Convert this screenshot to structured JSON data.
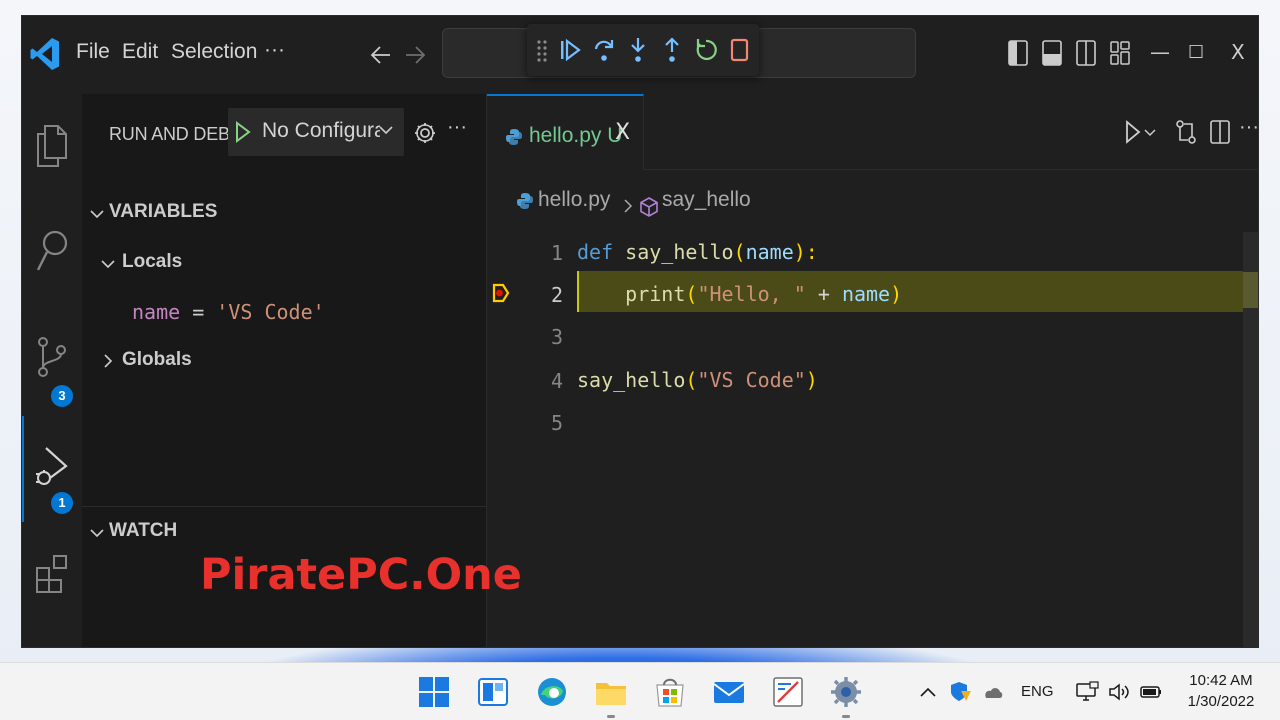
{
  "titlebar": {
    "menu": [
      "File",
      "Edit",
      "Selection",
      "···"
    ],
    "window_controls": [
      "—",
      "☐",
      "X"
    ]
  },
  "activity_bar": {
    "source_control_badge": "3",
    "run_debug_badge": "1"
  },
  "sidebar": {
    "title": "RUN AND DEBUG",
    "config_label": "No Configurations",
    "variables_header": "VARIABLES",
    "locals_label": "Locals",
    "local_var": {
      "name": "name",
      "eq": " = ",
      "value": "'VS Code'"
    },
    "globals_label": "Globals",
    "watch_header": "WATCH"
  },
  "editor": {
    "tab": {
      "label": "hello.py",
      "status": "U",
      "close": "X"
    },
    "breadcrumbs": [
      "hello.py",
      "say_hello"
    ],
    "line_numbers": [
      "1",
      "2",
      "3",
      "4",
      "5"
    ],
    "code": {
      "l1_kw": "def",
      "l1_fn": "say_hello",
      "l1_open": "(",
      "l1_param": "name",
      "l1_close": "):",
      "l2_fn": "print",
      "l2_open": "(",
      "l2_str": "\"Hello, \"",
      "l2_op": " + ",
      "l2_var": "name",
      "l2_close": ")",
      "l4_fn": "say_hello",
      "l4_open": "(",
      "l4_str": "\"VS Code\"",
      "l4_close": ")"
    },
    "current_line": 2
  },
  "watermark": "PiratePC.One",
  "taskbar": {
    "language": "ENG",
    "time": "10:42 AM",
    "date": "1/30/2022"
  },
  "colors": {
    "accent": "#0078d4",
    "highlight_line": "#4b4b18",
    "untracked_file": "#73c991",
    "watermark": "#e8312c"
  }
}
